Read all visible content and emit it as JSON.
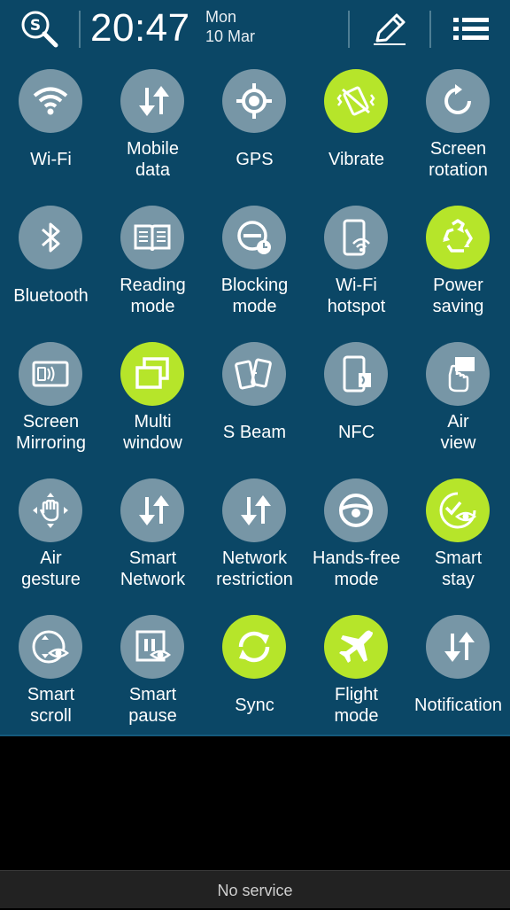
{
  "header": {
    "time": "20:47",
    "day": "Mon",
    "date": "10 Mar",
    "search_icon": "s-finder-icon",
    "edit_icon": "pencil-icon",
    "list_icon": "list-icon"
  },
  "toggles": [
    {
      "label": "Wi-Fi",
      "icon": "wifi-icon",
      "on": false
    },
    {
      "label": "Mobile\ndata",
      "icon": "data-arrows-icon",
      "on": false
    },
    {
      "label": "GPS",
      "icon": "gps-icon",
      "on": false
    },
    {
      "label": "Vibrate",
      "icon": "vibrate-icon",
      "on": true
    },
    {
      "label": "Screen\nrotation",
      "icon": "rotation-icon",
      "on": false
    },
    {
      "label": "Bluetooth",
      "icon": "bluetooth-icon",
      "on": false
    },
    {
      "label": "Reading\nmode",
      "icon": "book-icon",
      "on": false
    },
    {
      "label": "Blocking\nmode",
      "icon": "blocking-icon",
      "on": false
    },
    {
      "label": "Wi-Fi\nhotspot",
      "icon": "hotspot-icon",
      "on": false
    },
    {
      "label": "Power\nsaving",
      "icon": "recycle-icon",
      "on": true
    },
    {
      "label": "Screen\nMirroring",
      "icon": "mirroring-icon",
      "on": false
    },
    {
      "label": "Multi\nwindow",
      "icon": "multiwindow-icon",
      "on": true
    },
    {
      "label": "S Beam",
      "icon": "sbeam-icon",
      "on": false
    },
    {
      "label": "NFC",
      "icon": "nfc-icon",
      "on": false
    },
    {
      "label": "Air\nview",
      "icon": "airview-icon",
      "on": false
    },
    {
      "label": "Air\ngesture",
      "icon": "airgesture-icon",
      "on": false
    },
    {
      "label": "Smart\nNetwork",
      "icon": "data-arrows-icon",
      "on": false
    },
    {
      "label": "Network\nrestriction",
      "icon": "data-arrows-icon",
      "on": false
    },
    {
      "label": "Hands-free\nmode",
      "icon": "steering-wheel-icon",
      "on": false
    },
    {
      "label": "Smart\nstay",
      "icon": "smartstay-icon",
      "on": true
    },
    {
      "label": "Smart\nscroll",
      "icon": "smartscroll-icon",
      "on": false
    },
    {
      "label": "Smart\npause",
      "icon": "smartpause-icon",
      "on": false
    },
    {
      "label": "Sync",
      "icon": "sync-icon",
      "on": true
    },
    {
      "label": "Flight\nmode",
      "icon": "airplane-icon",
      "on": true
    },
    {
      "label": "Notification",
      "icon": "data-arrows-icon",
      "on": false
    }
  ],
  "status": {
    "text": "No service"
  },
  "colors": {
    "panel": "#0b4766",
    "tile_off": "#7796a6",
    "tile_on": "#b6e52a"
  }
}
